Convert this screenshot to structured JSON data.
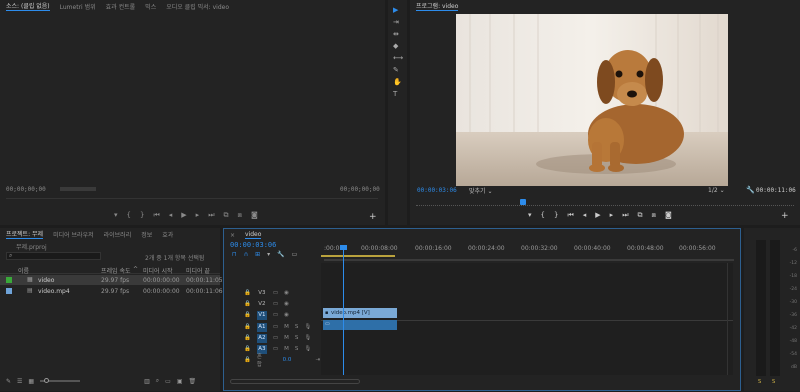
{
  "source_panel": {
    "tabs": [
      "소스: (클립 없음)",
      "Lumetri 범위",
      "효과 컨트롤",
      "믹스",
      "오디오 클립 믹서: video"
    ],
    "timecode_left": "00;00;00;00",
    "timecode_right": "00;00;00;00"
  },
  "program_panel": {
    "title": "프로그램: video",
    "timecode": "00:00:03:06",
    "fit_label": "맞추기",
    "resolution": "1/2",
    "duration": "00:00:11:06"
  },
  "tools": [
    "selection-tool",
    "track-select-tool",
    "ripple-edit-tool",
    "razor-tool",
    "slip-tool",
    "pen-tool",
    "hand-tool",
    "type-tool"
  ],
  "project_panel": {
    "tabs": [
      "프로젝트: 무제",
      "미디어 브라우저",
      "라이브러리",
      "정보",
      "효과"
    ],
    "project_file": "무제.prproj",
    "search_placeholder": "",
    "selection_info": "2개 중 1개 항목 선택됨",
    "columns": [
      "이름",
      "프레임 속도",
      "미디어 시작",
      "미디어 끝"
    ],
    "items": [
      {
        "name": "video",
        "fps": "29.97 fps",
        "start": "00:00:00:00",
        "end": "00:00:11:05",
        "color": "#3aa83a"
      },
      {
        "name": "video.mp4",
        "fps": "29.97 fps",
        "start": "00:00:00:00",
        "end": "00:00:11:06",
        "color": "#6fa3d8"
      }
    ]
  },
  "timeline": {
    "sequence_tab": "video",
    "timecode": "00:00:03:06",
    "ruler_labels": [
      ":00:00",
      "00:00:08:00",
      "00:00:16:00",
      "00:00:24:00",
      "00:00:32:00",
      "00:00:40:00",
      "00:00:48:00",
      "00:00:56:00"
    ],
    "video_tracks": [
      "V3",
      "V2",
      "V1"
    ],
    "audio_tracks": [
      "A1",
      "A2",
      "A3"
    ],
    "mix_label": "혼합",
    "mix_value": "0.0",
    "clip_video_label": "video.mp4 [V]"
  },
  "audio_meter": {
    "labels": [
      "-6",
      "-12",
      "-18",
      "-24",
      "-30",
      "-36",
      "-42",
      "-48",
      "-54",
      "dB"
    ],
    "bottom_left": "S",
    "bottom_right": "S"
  },
  "colors": {
    "accent": "#2d8ceb",
    "clip_video": "#7aa9d6",
    "clip_audio": "#2e6fa8",
    "playhead": "#2d8ceb"
  }
}
